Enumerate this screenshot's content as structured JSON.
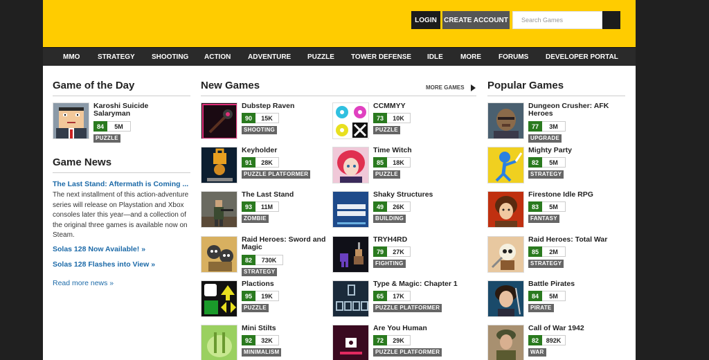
{
  "header": {
    "login_label": "LOGIN",
    "create_account_label": "CREATE ACCOUNT",
    "search_placeholder": "Search Games"
  },
  "nav": [
    "MMO",
    "STRATEGY",
    "SHOOTING",
    "ACTION",
    "ADVENTURE",
    "PUZZLE",
    "TOWER DEFENSE",
    "IDLE",
    "MORE",
    "FORUMS",
    "DEVELOPER PORTAL"
  ],
  "game_of_day": {
    "heading": "Game of the Day",
    "game": {
      "title": "Karoshi Suicide Salaryman",
      "score": "84",
      "plays": "5M",
      "tag": "PUZZLE"
    }
  },
  "news": {
    "heading": "Game News",
    "items": [
      "The Last Stand: Aftermath is Coming ...",
      "Solas 128 Now Available! »",
      "Solas 128 Flashes into View »"
    ],
    "body": "The next installment of this action-adventure series will release on Playstation and Xbox consoles later this year—and a collection of the original three games is available now on Steam.",
    "read_more": "Read more news »"
  },
  "new_games": {
    "heading": "New Games",
    "more_label": "MORE GAMES",
    "left": [
      {
        "title": "Dubstep Raven",
        "score": "90",
        "plays": "15K",
        "tag": "SHOOTING",
        "icon": "raven-staff-icon"
      },
      {
        "title": "Keyholder",
        "score": "91",
        "plays": "28K",
        "tag": "PUZZLE PLATFORMER",
        "icon": "keyholder-icon"
      },
      {
        "title": "The Last Stand",
        "score": "93",
        "plays": "11M",
        "tag": "ZOMBIE",
        "icon": "soldier-icon"
      },
      {
        "title": "Raid Heroes: Sword and Magic",
        "score": "82",
        "plays": "730K",
        "tag": "STRATEGY",
        "icon": "raid-heroes-icon"
      },
      {
        "title": "Plactions",
        "score": "95",
        "plays": "19K",
        "tag": "PUZZLE",
        "icon": "plactions-icon"
      },
      {
        "title": "Mini Stilts",
        "score": "92",
        "plays": "32K",
        "tag": "MINIMALISM",
        "icon": "mini-stilts-icon"
      }
    ],
    "right": [
      {
        "title": "CCMMYY",
        "score": "73",
        "plays": "10K",
        "tag": "PUZZLE",
        "icon": "gears-icon"
      },
      {
        "title": "Time Witch",
        "score": "85",
        "plays": "18K",
        "tag": "PUZZLE",
        "icon": "witch-icon"
      },
      {
        "title": "Shaky Structures",
        "score": "49",
        "plays": "26K",
        "tag": "BUILDING",
        "icon": "shaky-structures-icon"
      },
      {
        "title": "TRYH4RD",
        "score": "79",
        "plays": "27K",
        "tag": "FIGHTING",
        "icon": "pixel-fighter-icon"
      },
      {
        "title": "Type & Magic: Chapter 1",
        "score": "65",
        "plays": "17K",
        "tag": "PUZZLE PLATFORMER",
        "icon": "type-magic-icon"
      },
      {
        "title": "Are You Human",
        "score": "72",
        "plays": "29K",
        "tag": "PUZZLE PLATFORMER",
        "icon": "are-you-human-icon"
      }
    ]
  },
  "popular_games": {
    "heading": "Popular Games",
    "items": [
      {
        "title": "Dungeon Crusher: AFK Heroes",
        "score": "77",
        "plays": "3M",
        "tag": "UPGRADE",
        "icon": "dungeon-crusher-icon"
      },
      {
        "title": "Mighty Party",
        "score": "82",
        "plays": "5M",
        "tag": "STRATEGY",
        "icon": "stick-hero-icon"
      },
      {
        "title": "Firestone Idle RPG",
        "score": "83",
        "plays": "5M",
        "tag": "FANTASY",
        "icon": "firestone-icon"
      },
      {
        "title": "Raid Heroes: Total War",
        "score": "85",
        "plays": "2M",
        "tag": "STRATEGY",
        "icon": "skull-warrior-icon"
      },
      {
        "title": "Battle Pirates",
        "score": "84",
        "plays": "5M",
        "tag": "PIRATE",
        "icon": "pirate-icon"
      },
      {
        "title": "Call of War 1942",
        "score": "82",
        "plays": "892K",
        "tag": "WAR",
        "icon": "war-soldier-icon"
      }
    ]
  }
}
